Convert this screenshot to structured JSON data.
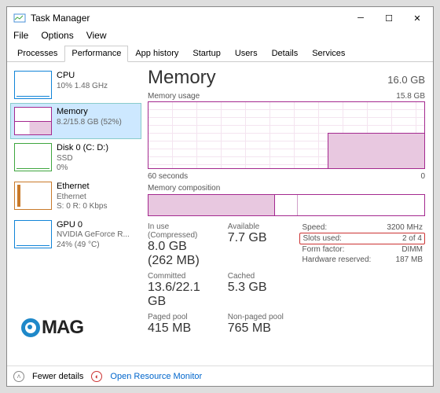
{
  "window": {
    "title": "Task Manager"
  },
  "menu": {
    "file": "File",
    "options": "Options",
    "view": "View"
  },
  "tabs": [
    "Processes",
    "Performance",
    "App history",
    "Startup",
    "Users",
    "Details",
    "Services"
  ],
  "activeTab": 1,
  "sidebar": {
    "items": [
      {
        "name": "CPU",
        "sub": "10%   1.48 GHz"
      },
      {
        "name": "Memory",
        "sub": "8.2/15.8 GB (52%)"
      },
      {
        "name": "Disk 0 (C: D:)",
        "sub": "SSD",
        "sub2": "0%"
      },
      {
        "name": "Ethernet",
        "sub": "Ethernet",
        "sub2": "S: 0 R: 0 Kbps"
      },
      {
        "name": "GPU 0",
        "sub": "NVIDIA GeForce R...",
        "sub2": "24% (49 °C)"
      }
    ]
  },
  "main": {
    "title": "Memory",
    "capacity": "16.0 GB",
    "usageLabel": "Memory usage",
    "usageMax": "15.8 GB",
    "xLeft": "60 seconds",
    "xRight": "0",
    "compLabel": "Memory composition",
    "stats": {
      "inUseLabel": "In use (Compressed)",
      "inUse": "8.0 GB (262 MB)",
      "availLabel": "Available",
      "avail": "7.7 GB",
      "commitLabel": "Committed",
      "commit": "13.6/22.1 GB",
      "cachedLabel": "Cached",
      "cached": "5.3 GB",
      "pagedLabel": "Paged pool",
      "paged": "415 MB",
      "nonpagedLabel": "Non-paged pool",
      "nonpaged": "765 MB"
    },
    "right": {
      "speedL": "Speed:",
      "speed": "3200 MHz",
      "slotsL": "Slots used:",
      "slots": "2 of 4",
      "formL": "Form factor:",
      "form": "DIMM",
      "hwL": "Hardware reserved:",
      "hw": "187 MB"
    }
  },
  "footer": {
    "fewer": "Fewer details",
    "orm": "Open Resource Monitor"
  },
  "logo": "MAG"
}
